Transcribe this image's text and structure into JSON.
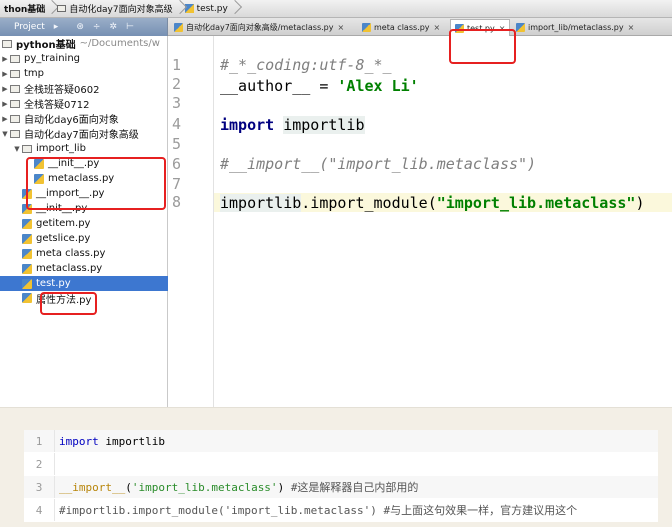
{
  "nav": {
    "crumbs": [
      "thon基础",
      "自动化day7面向对象高级",
      "test.py"
    ]
  },
  "toolbar": {
    "project_label": "Project",
    "tabs": [
      {
        "label": "自动化day7面向对象高级/metaclass.py",
        "close": "×",
        "active": false
      },
      {
        "label": "meta class.py",
        "close": "×",
        "active": false
      },
      {
        "label": "test.py",
        "close": "×",
        "active": true
      },
      {
        "label": "import_lib/metaclass.py",
        "close": "×",
        "active": false
      }
    ]
  },
  "project_tree": {
    "root_label": "python基础",
    "root_path": "~/Documents/w",
    "items": [
      {
        "label": "py_training"
      },
      {
        "label": "tmp"
      },
      {
        "label": "全栈班答疑0602"
      },
      {
        "label": "全栈答疑0712"
      },
      {
        "label": "自动化day6面向对象"
      },
      {
        "label": "自动化day7面向对象高级"
      },
      {
        "label": "import_lib"
      },
      {
        "label": "__init__.py"
      },
      {
        "label": "metaclass.py"
      },
      {
        "label": "__import__.py"
      },
      {
        "label": "__init__.py"
      },
      {
        "label": "getitem.py"
      },
      {
        "label": "getslice.py"
      },
      {
        "label": "meta class.py"
      },
      {
        "label": "metaclass.py"
      },
      {
        "label": "test.py"
      },
      {
        "label": "属性方法.py"
      }
    ]
  },
  "editor": {
    "line_numbers": [
      "1",
      "2",
      "3",
      "4",
      "5",
      "6",
      "7",
      "8"
    ],
    "lines": {
      "l1": "#_*_coding:utf-8_*_",
      "l2_var": "__author__",
      "l2_eq": " = ",
      "l2_str": "'Alex Li'",
      "l4_kw": "import",
      "l4_mod": "importlib",
      "l6": "#__import__(\"import_lib.metaclass\")",
      "l8_a": "importlib",
      "l8_b": ".import_module(",
      "l8_str": "\"import_lib.metaclass\"",
      "l8_c": ")"
    }
  },
  "snippet": {
    "rows": [
      {
        "num": "1",
        "kw": "import",
        "rest": " importlib"
      },
      {
        "num": "2"
      },
      {
        "num": "3",
        "dunder": "__import__",
        "open": "(",
        "str": "'import_lib.metaclass'",
        "close": ") ",
        "comment": "#这是解释器自己内部用的"
      },
      {
        "num": "4",
        "text": "#importlib.import_module('import_lib.metaclass') #与上面这句效果一样，官方建议用这个"
      }
    ]
  },
  "colors": {
    "highlight_box": "#e62020",
    "selection": "#3d77d0",
    "page_bg": "#f3efe6"
  }
}
